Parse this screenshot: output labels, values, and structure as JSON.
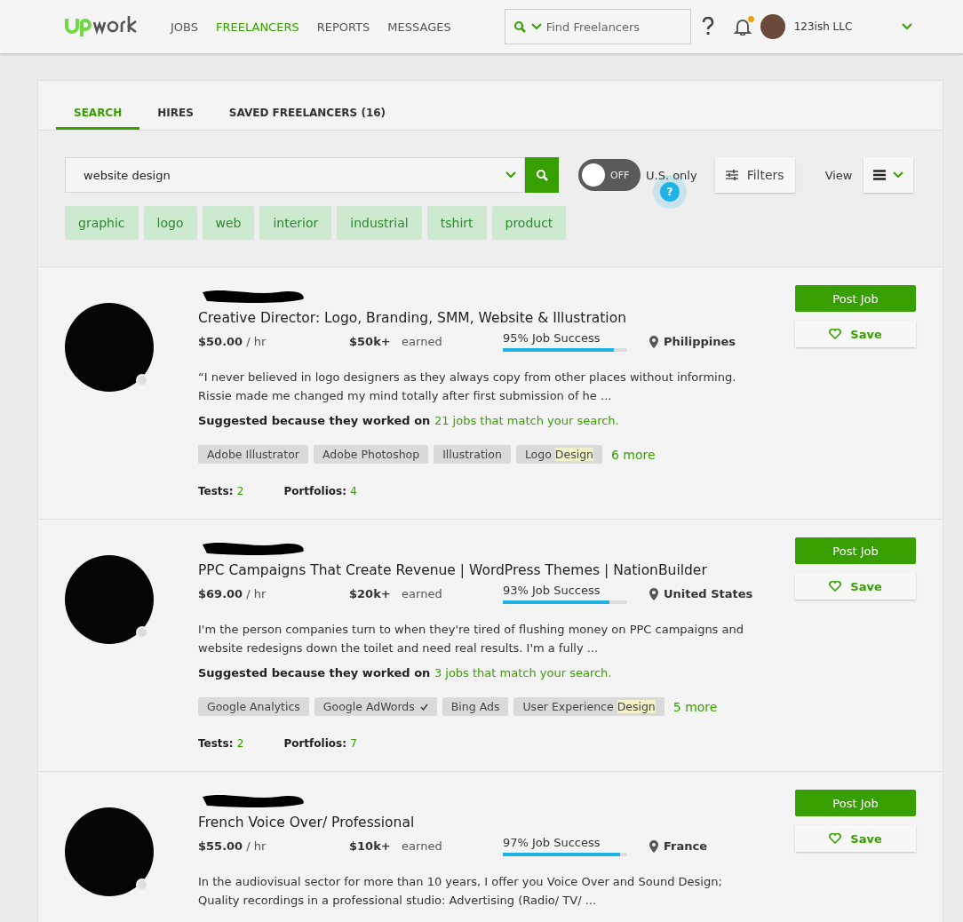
{
  "nav": {
    "links": [
      {
        "label": "JOBS",
        "selected": false
      },
      {
        "label": "FREELANCERS",
        "selected": true
      },
      {
        "label": "REPORTS",
        "selected": false
      },
      {
        "label": "MESSAGES",
        "selected": false
      }
    ],
    "search": {
      "placeholder": "Find Freelancers"
    },
    "notifications": {
      "unread": true
    },
    "account": {
      "name": "123ish LLC"
    }
  },
  "tabs": [
    {
      "label": "SEARCH",
      "selected": true
    },
    {
      "label": "HIRES",
      "selected": false
    },
    {
      "label": "SAVED FREELANCERS (16)",
      "selected": false
    }
  ],
  "query": {
    "value": "website design"
  },
  "us_only": {
    "on": false,
    "state_label": "OFF",
    "label": "U.S. only",
    "help": "?"
  },
  "filters_label": "Filters",
  "view_label": "View",
  "suggestions": [
    "graphic",
    "logo",
    "web",
    "interior",
    "industrial",
    "tshirt",
    "product"
  ],
  "freelancers": [
    {
      "title": "Creative Director: Logo, Branding, SMM, Website & Illustration",
      "rate": "$50.00",
      "rate_unit": "/ hr",
      "earned": "$50k+",
      "earned_label": "earned",
      "job_success": "95% Job Success",
      "level": 0.89,
      "location": "Philippines",
      "description": "“I never believed in logo designers as they always copy from other places without informing. Rissie made me changed my mind totally after first submission of he ...",
      "suggested": "Suggested because they worked on",
      "suggested_link": "21 jobs that match your search.",
      "skills": [
        {
          "parts": [
            {
              "text": "Adobe Illustrator",
              "highlighted": false
            }
          ],
          "verified": false
        },
        {
          "parts": [
            {
              "text": "Adobe Photoshop",
              "highlighted": false
            }
          ],
          "verified": false
        },
        {
          "parts": [
            {
              "text": "Illustration",
              "highlighted": false
            }
          ],
          "verified": false
        },
        {
          "parts": [
            {
              "text": "Logo ",
              "highlighted": false
            },
            {
              "text": "Design",
              "highlighted": true
            }
          ],
          "verified": false
        }
      ],
      "more": "6 more",
      "tests_label": "Tests:",
      "tests": "2",
      "portfolios_label": "Portfolios:",
      "portfolios": "4",
      "save": "Save",
      "post_job": "Post Job"
    },
    {
      "title": "PPC Campaigns That Create Revenue | WordPress Themes | NationBuilder",
      "rate": "$69.00",
      "rate_unit": "/ hr",
      "earned": "$20k+",
      "earned_label": "earned",
      "job_success": "93% Job Success",
      "level": 0.86,
      "location": "United States",
      "description": "I'm the person companies turn to when they're tired of flushing money on PPC campaigns and website redesigns down the toilet and need real results. I'm a fully ...",
      "suggested": "Suggested because they worked on",
      "suggested_link": "3 jobs that match your search.",
      "skills": [
        {
          "parts": [
            {
              "text": "Google Analytics",
              "highlighted": false
            }
          ],
          "verified": false
        },
        {
          "parts": [
            {
              "text": "Google AdWords",
              "highlighted": false
            }
          ],
          "verified": true
        },
        {
          "parts": [
            {
              "text": "Bing Ads",
              "highlighted": false
            }
          ],
          "verified": false
        },
        {
          "parts": [
            {
              "text": "User Experience ",
              "highlighted": false
            },
            {
              "text": "Design",
              "highlighted": true
            }
          ],
          "verified": false
        }
      ],
      "more": "5 more",
      "tests_label": "Tests:",
      "tests": "2",
      "portfolios_label": "Portfolios:",
      "portfolios": "7",
      "save": "Save",
      "post_job": "Post Job"
    },
    {
      "title": "French Voice Over/ Professional",
      "rate": "$55.00",
      "rate_unit": "/ hr",
      "earned": "$10k+",
      "earned_label": "earned",
      "job_success": "97% Job Success",
      "level": 0.94,
      "location": "France",
      "description": "In the audiovisual sector for more than 10 years, I offer you Voice Over and Sound Design; Quality recordings in a professional studio: Advertising (Radio/ TV/ ...",
      "save": "Save",
      "post_job": "Post Job"
    }
  ]
}
